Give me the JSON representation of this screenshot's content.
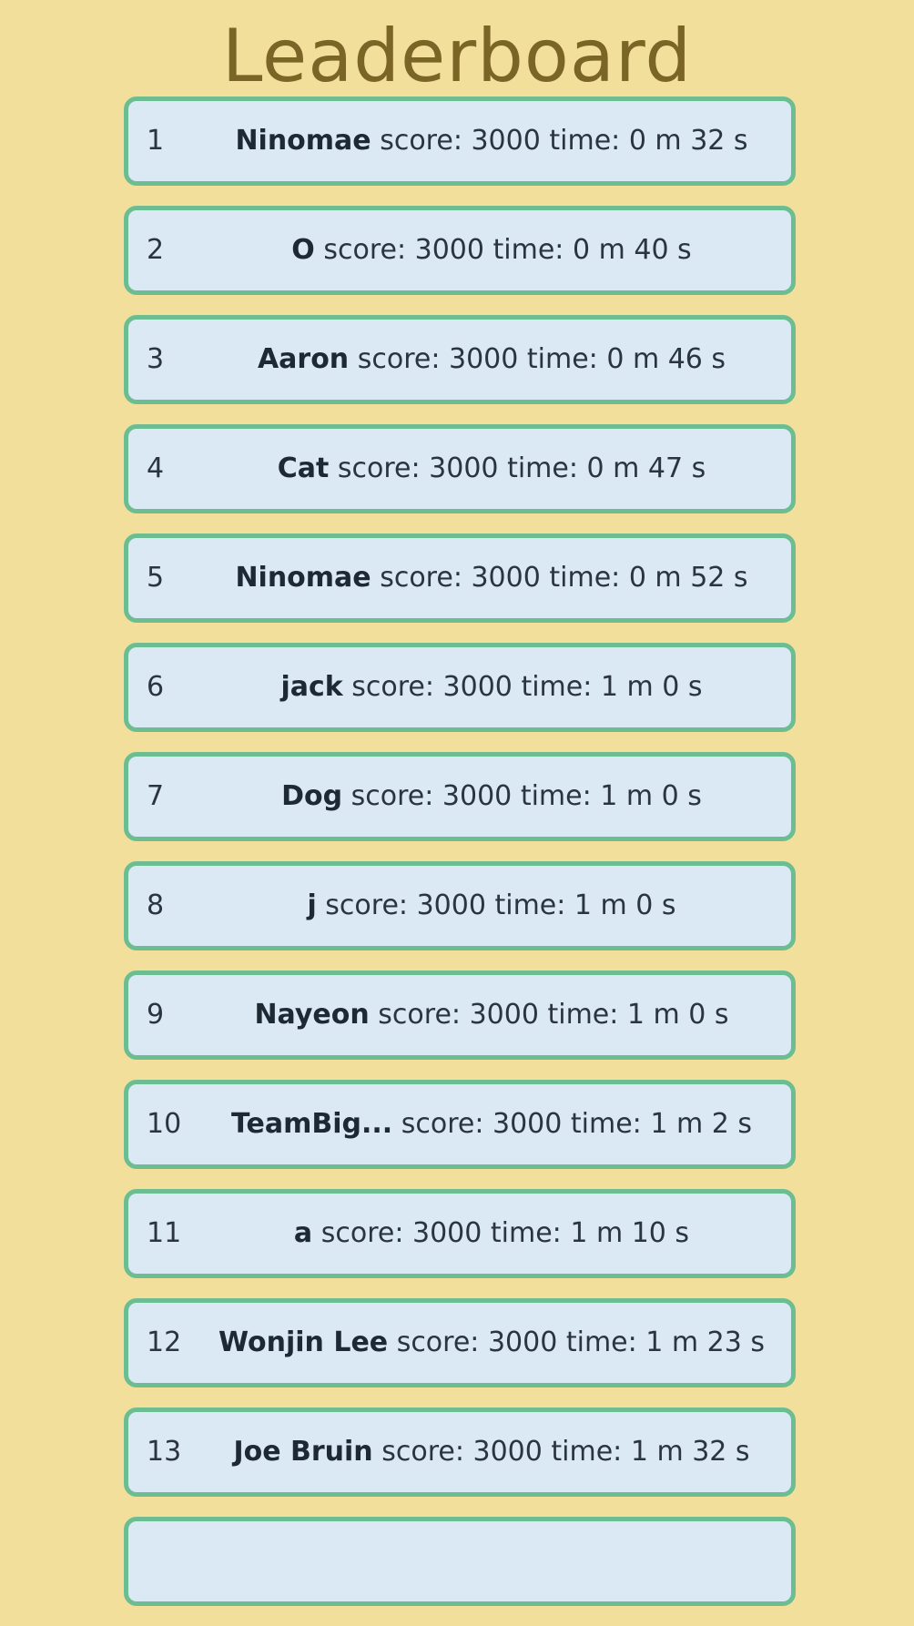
{
  "page": {
    "title": "Leaderboard"
  },
  "labels": {
    "score": "score:",
    "time": "time:"
  },
  "colors": {
    "background": "#f2df9c",
    "title": "#7a6526",
    "row_background": "#dae9f4",
    "row_border": "#6dbd93"
  },
  "entries": [
    {
      "rank": "1",
      "name": "Ninomae",
      "score": "3000",
      "time": "0 m 32 s"
    },
    {
      "rank": "2",
      "name": "O",
      "score": "3000",
      "time": "0 m 40 s"
    },
    {
      "rank": "3",
      "name": "Aaron",
      "score": "3000",
      "time": "0 m 46 s"
    },
    {
      "rank": "4",
      "name": "Cat",
      "score": "3000",
      "time": "0 m 47 s"
    },
    {
      "rank": "5",
      "name": "Ninomae",
      "score": "3000",
      "time": "0 m 52 s"
    },
    {
      "rank": "6",
      "name": "jack",
      "score": "3000",
      "time": "1 m 0 s"
    },
    {
      "rank": "7",
      "name": "Dog",
      "score": "3000",
      "time": "1 m 0 s"
    },
    {
      "rank": "8",
      "name": "j",
      "score": "3000",
      "time": "1 m 0 s"
    },
    {
      "rank": "9",
      "name": "Nayeon",
      "score": "3000",
      "time": "1 m 0 s"
    },
    {
      "rank": "10",
      "name": "TeamBig...",
      "score": "3000",
      "time": "1 m 2 s"
    },
    {
      "rank": "11",
      "name": "a",
      "score": "3000",
      "time": "1 m 10 s"
    },
    {
      "rank": "12",
      "name": "Wonjin Lee",
      "score": "3000",
      "time": "1 m 23 s"
    },
    {
      "rank": "13",
      "name": "Joe Bruin",
      "score": "3000",
      "time": "1 m 32 s"
    },
    {
      "rank": "",
      "name": "",
      "score": "",
      "time": ""
    }
  ]
}
